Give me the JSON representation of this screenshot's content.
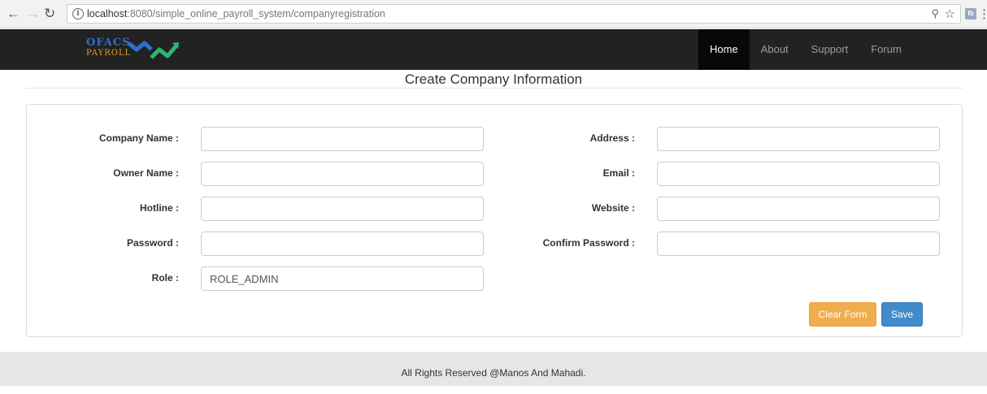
{
  "browser": {
    "url_host": "localhost",
    "url_rest": ":8080/simple_online_payroll_system/companyregistration",
    "ext_label": "fb"
  },
  "navbar": {
    "logo_line1": "OFACS",
    "logo_line2": "PAYROLL",
    "items": [
      {
        "label": "Home"
      },
      {
        "label": "About"
      },
      {
        "label": "Support"
      },
      {
        "label": "Forum"
      }
    ]
  },
  "page": {
    "title": "Create Company Information"
  },
  "form": {
    "company_name": {
      "label": "Company Name :",
      "value": ""
    },
    "owner_name": {
      "label": "Owner Name :",
      "value": ""
    },
    "hotline": {
      "label": "Hotline :",
      "value": ""
    },
    "password": {
      "label": "Password :",
      "value": ""
    },
    "role": {
      "label": "Role :",
      "value": "ROLE_ADMIN"
    },
    "address": {
      "label": "Address :",
      "value": ""
    },
    "email": {
      "label": "Email :",
      "value": ""
    },
    "website": {
      "label": "Website :",
      "value": ""
    },
    "confirm_password": {
      "label": "Confirm Password :",
      "value": ""
    },
    "clear_label": "Clear Form",
    "save_label": "Save"
  },
  "footer": {
    "text": "All Rights Reserved @Manos And Mahadi."
  },
  "colors": {
    "navbar": "#222222",
    "clear_button": "#f0ad4e",
    "save_button": "#428bca"
  }
}
